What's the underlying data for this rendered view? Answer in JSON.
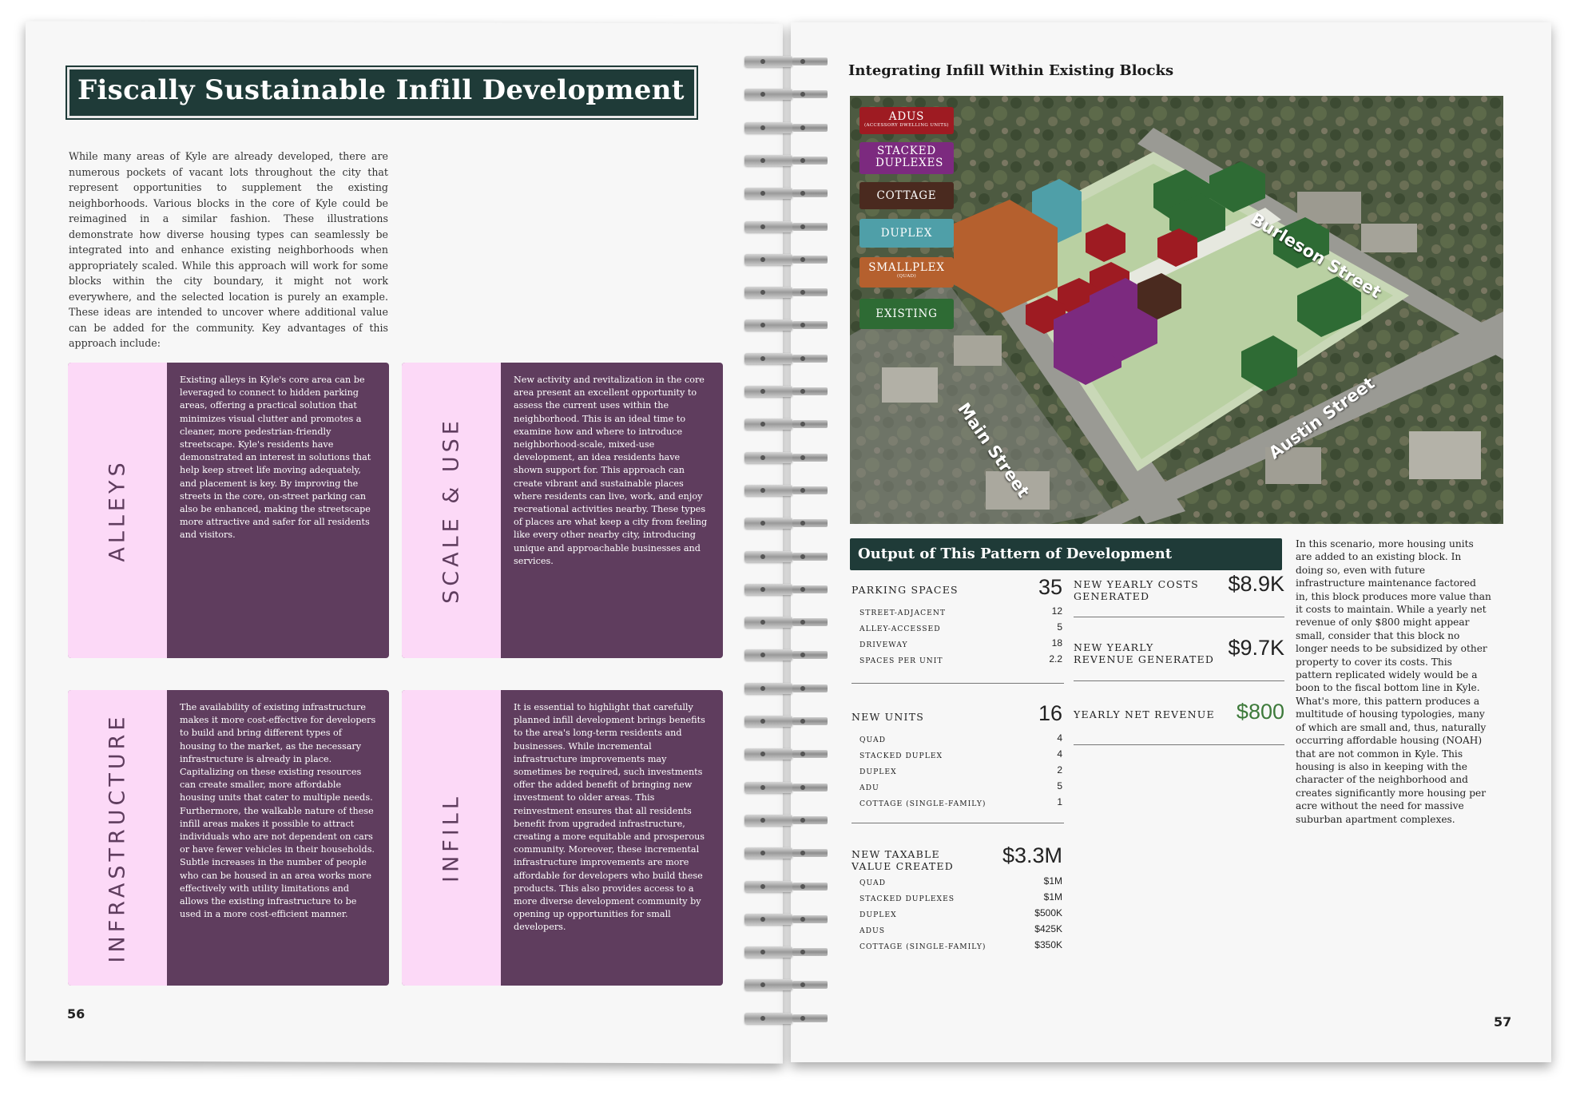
{
  "left_page": {
    "title": "Fiscally Sustainable Infill Development",
    "intro": "While many areas of Kyle are already developed, there are numerous pockets of vacant lots throughout the city that represent opportunities to supplement the existing neighborhoods. Various blocks in the core of Kyle could be reimagined in a similar fashion. These illustrations demonstrate how diverse housing types can seamlessly be integrated into and enhance existing neighborhoods when appropriately scaled. While this approach will work for some blocks within the city boundary, it might not work everywhere, and the selected location is purely an example. These ideas are intended to uncover where additional value can be added for the community. Key advantages of this approach include:",
    "cards": [
      {
        "label": "ALLEYS",
        "text": "Existing alleys in Kyle's core area can be leveraged to connect to hidden parking areas, offering a practical solution that minimizes visual clutter and promotes a cleaner, more pedestrian-friendly streetscape. Kyle's residents have demonstrated an interest in solutions that help keep street life moving adequately, and placement is key. By improving the streets in the core, on-street parking can also be enhanced, making the streetscape more attractive and safer for all residents and visitors."
      },
      {
        "label": "SCALE & USE",
        "text": "New activity and revitalization in the core area present an excellent opportunity to assess the current uses within the neighborhood. This is an ideal time to examine how and where to introduce neighborhood-scale, mixed-use development, an idea residents have shown support for. This approach can create vibrant and sustainable places where residents can live, work, and enjoy recreational activities nearby. These types of places are what keep a city from feeling like every other nearby city, introducing unique and approachable businesses and services."
      },
      {
        "label": "INFRASTRUCTURE",
        "text": "The availability of existing infrastructure makes it more cost-effective for developers to build and bring different types of housing to the market, as the necessary infrastructure is already in place. Capitalizing on these existing resources can create smaller, more affordable housing units that cater to multiple needs. Furthermore, the walkable nature of these infill areas makes it possible to attract individuals who are not dependent on cars or have fewer vehicles in their households. Subtle increases in the number of people who can be housed in an area works more effectively with utility limitations and allows the existing infrastructure to be used in a more cost-efficient manner."
      },
      {
        "label": "INFILL",
        "text": "It is essential to highlight that carefully planned infill development brings benefits to the area's long-term residents and businesses. While incremental infrastructure improvements may sometimes be required, such investments offer the added benefit of bringing new investment to older areas. This reinvestment ensures that all residents benefit from upgraded infrastructure, creating a more equitable and prosperous community. Moreover, these incremental infrastructure improvements are more affordable for developers who build these products. This also provides access to a more diverse development community by opening up opportunities for small developers."
      }
    ],
    "page_number": "56"
  },
  "right_page": {
    "heading": "Integrating Infill Within Existing Blocks",
    "legend": [
      {
        "label": "ADUS",
        "sub": "(ACCESSORY DWELLING UNITS)",
        "color": "#9e1b22"
      },
      {
        "label": "STACKED DUPLEXES",
        "sub": "",
        "color": "#7c2a7f"
      },
      {
        "label": "COTTAGE",
        "sub": "",
        "color": "#4a2a1f"
      },
      {
        "label": "DUPLEX",
        "sub": "",
        "color": "#4f9fa8"
      },
      {
        "label": "SMALLPLEX",
        "sub": "(QUAD)",
        "color": "#b5602e"
      },
      {
        "label": "EXISTING",
        "sub": "",
        "color": "#2e6b34"
      }
    ],
    "streets": {
      "main": "Main Street",
      "austin": "Austin Street",
      "burleson": "Burleson Street"
    },
    "output_heading": "Output of This Pattern of Development",
    "parking": {
      "label": "PARKING SPACES",
      "value": "35",
      "items": [
        {
          "label": "STREET-ADJACENT",
          "value": "12"
        },
        {
          "label": "ALLEY-ACCESSED",
          "value": "5"
        },
        {
          "label": "DRIVEWAY",
          "value": "18"
        },
        {
          "label": "SPACES PER UNIT",
          "value": "2.2"
        }
      ]
    },
    "units": {
      "label": "NEW UNITS",
      "value": "16",
      "items": [
        {
          "label": "QUAD",
          "value": "4"
        },
        {
          "label": "STACKED DUPLEX",
          "value": "4"
        },
        {
          "label": "DUPLEX",
          "value": "2"
        },
        {
          "label": "ADU",
          "value": "5"
        },
        {
          "label": "COTTAGE (SINGLE-FAMILY)",
          "value": "1"
        }
      ]
    },
    "taxable": {
      "label_line1": "NEW TAXABLE",
      "label_line2": "VALUE CREATED",
      "value": "$3.3M",
      "items": [
        {
          "label": "QUAD",
          "value": "$1M"
        },
        {
          "label": "STACKED DUPLEXES",
          "value": "$1M"
        },
        {
          "label": "DUPLEX",
          "value": "$500K"
        },
        {
          "label": "ADUS",
          "value": "$425K"
        },
        {
          "label": "COTTAGE (SINGLE-FAMILY)",
          "value": "$350K"
        }
      ]
    },
    "costs": {
      "label_line1": "NEW YEARLY COSTS",
      "label_line2": "GENERATED",
      "value": "$8.9K"
    },
    "revenue": {
      "label_line1": "NEW YEARLY",
      "label_line2": "REVENUE GENERATED",
      "value": "$9.7K"
    },
    "net": {
      "label": "YEARLY NET REVENUE",
      "value": "$800",
      "color": "#3d7a3a"
    },
    "scenario": "In this scenario, more housing units are added to an existing block. In doing so, even with future infrastructure maintenance factored in, this block produces more value than it costs to maintain. While a yearly net revenue of only $800 might appear small, consider that this block no longer needs to be subsidized by other property to cover its costs. This pattern replicated widely would be a boon to the fiscal bottom line in Kyle. What's more, this pattern produces a multitude of housing typologies, many of which are small and, thus, naturally occurring affordable housing (NOAH) that are not common in Kyle. This housing is also in keeping with the character of the neighborhood and creates significantly more housing per acre without the need for massive suburban apartment complexes.",
    "page_number": "57"
  }
}
